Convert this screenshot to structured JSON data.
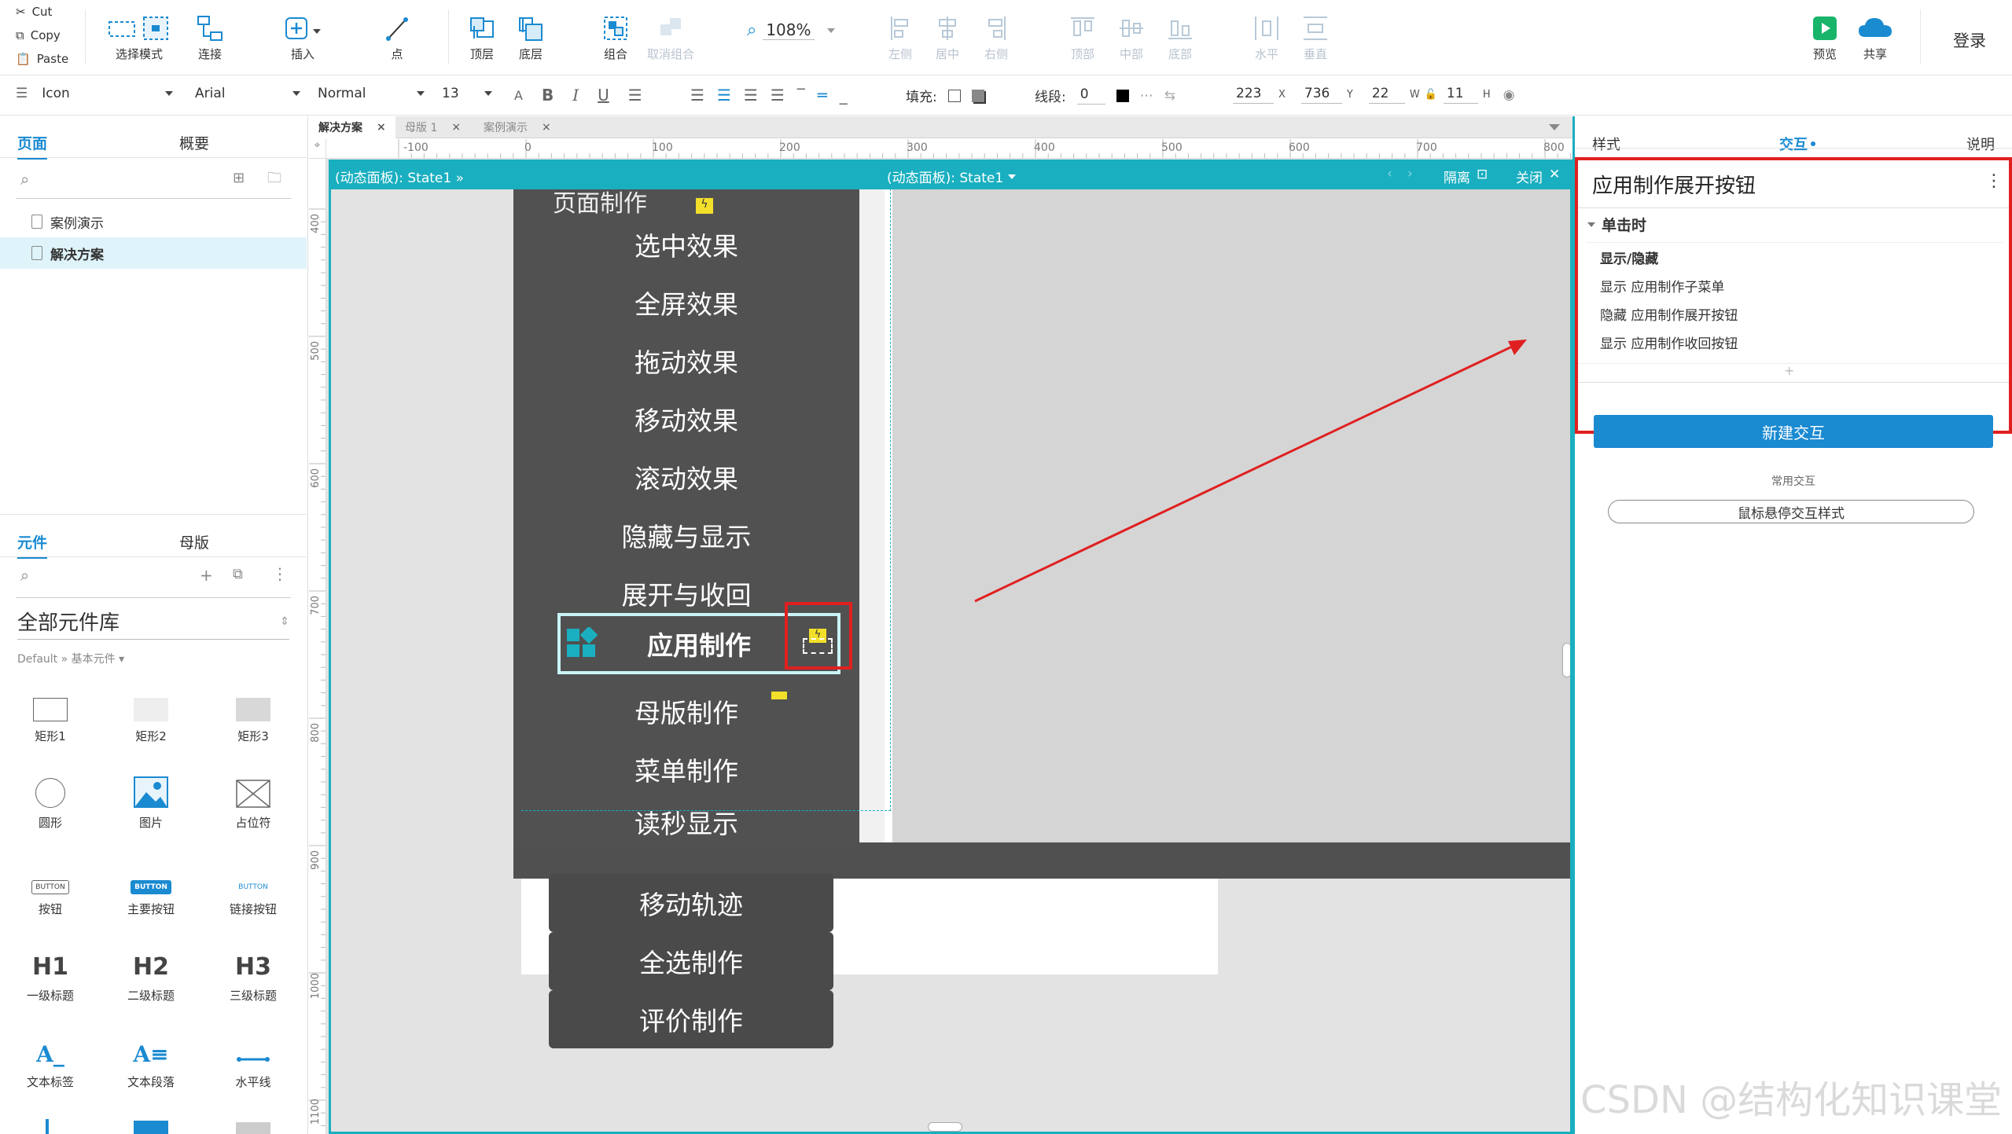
{
  "clipboard": {
    "cut": "Cut",
    "copy": "Copy",
    "paste": "Paste"
  },
  "toolbar": {
    "select_mode": "选择模式",
    "connect": "连接",
    "insert": "插入",
    "point": "点",
    "top_layer": "顶层",
    "bottom_layer": "底层",
    "group": "组合",
    "ungroup": "取消组合",
    "zoom": "108%",
    "align_left": "左侧",
    "align_center": "居中",
    "align_right": "右侧",
    "align_top": "顶部",
    "align_middle": "中部",
    "align_bottom": "底部",
    "dist_horizontal": "水平",
    "dist_vertical": "垂直",
    "preview": "预览",
    "share": "共享",
    "login": "登录"
  },
  "format": {
    "style": "Icon",
    "font": "Arial",
    "weight": "Normal",
    "size": "13",
    "fill_label": "填充:",
    "stroke_label": "线段:",
    "stroke_value": "0",
    "x": "223",
    "x_label": "X",
    "y": "736",
    "y_label": "Y",
    "w": "22",
    "w_label": "W",
    "h": "11",
    "h_label": "H"
  },
  "left": {
    "pages_tab": "页面",
    "outline_tab": "概要",
    "pages": [
      "案例演示",
      "解决方案"
    ],
    "widgets_tab": "元件",
    "masters_tab": "母版",
    "library": "全部元件库",
    "breadcrumb": "Default » 基本元件 ▾",
    "widgets": [
      {
        "label": "矩形1",
        "icon": "rect-outline-icon"
      },
      {
        "label": "矩形2",
        "icon": "rect-light-icon"
      },
      {
        "label": "矩形3",
        "icon": "rect-gray-icon"
      },
      {
        "label": "圆形",
        "icon": "circle-icon"
      },
      {
        "label": "图片",
        "icon": "image-icon"
      },
      {
        "label": "占位符",
        "icon": "placeholder-icon"
      },
      {
        "label": "按钮",
        "icon": "button-icon",
        "text": "BUTTON"
      },
      {
        "label": "主要按钮",
        "icon": "primary-button-icon",
        "text": "BUTTON"
      },
      {
        "label": "链接按钮",
        "icon": "link-button-icon",
        "text": "BUTTON"
      },
      {
        "label": "一级标题",
        "icon": "h1-icon",
        "text": "H1"
      },
      {
        "label": "二级标题",
        "icon": "h2-icon",
        "text": "H2"
      },
      {
        "label": "三级标题",
        "icon": "h3-icon",
        "text": "H3"
      },
      {
        "label": "文本标签",
        "icon": "text-label-icon",
        "text": "A_"
      },
      {
        "label": "文本段落",
        "icon": "text-paragraph-icon",
        "text": "A≡"
      },
      {
        "label": "水平线",
        "icon": "hline-icon"
      }
    ]
  },
  "doc_tabs": [
    "解决方案",
    "母版 1",
    "案例演示"
  ],
  "ruler_h": [
    "-100",
    "0",
    "100",
    "200",
    "300",
    "400",
    "500",
    "600",
    "700",
    "800"
  ],
  "ruler_v": [
    "400",
    "500",
    "600",
    "700",
    "800",
    "900",
    "1000",
    "1100"
  ],
  "dynamic_panel": {
    "left_label": "(动态面板): State1 »",
    "center_label": "(动态面板): State1",
    "isolate": "隔离",
    "close": "关闭"
  },
  "canvas": {
    "partial_top": "页面制作",
    "menu_items": [
      "选中效果",
      "全屏效果",
      "拖动效果",
      "移动效果",
      "滚动效果",
      "隐藏与显示",
      "展开与收回"
    ],
    "selected_item": "应用制作",
    "menu_items_after": [
      "母版制作",
      "菜单制作",
      "读秒显示"
    ],
    "buttons": [
      "移动轨迹",
      "全选制作",
      "评价制作"
    ]
  },
  "right": {
    "tab_style": "样式",
    "tab_interaction": "交互",
    "tab_notes": "说明",
    "widget_name": "应用制作展开按钮",
    "event": "单击时",
    "action_title": "显示/隐藏",
    "actions": [
      "显示 应用制作子菜单",
      "隐藏 应用制作展开按钮",
      "显示 应用制作收回按钮"
    ],
    "add": "+",
    "new_interaction": "新建交互",
    "common_label": "常用交互",
    "hover_style": "鼠标悬停交互样式"
  },
  "colors": {
    "accent": "#1aafc0",
    "primary": "#1a8ad1",
    "highlight": "#e02020",
    "menu_bg": "#515151"
  },
  "watermark": "CSDN @结构化知识课堂"
}
